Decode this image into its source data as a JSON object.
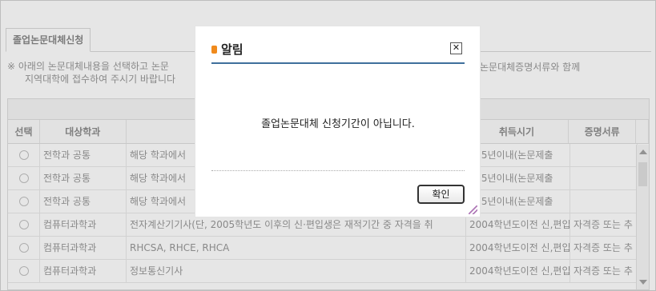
{
  "tab": {
    "label": "졸업논문대체신청"
  },
  "notice": {
    "line1": "※ 아래의 논문대체내용을 선택하고 논문",
    "line1_right": "논문대체증명서류와 함께",
    "line2": "지역대학에 접수하여 주시기 바랍니다"
  },
  "table": {
    "headers": {
      "select": "선택",
      "dept": "대상학과",
      "content": "",
      "period": "취득시기",
      "docs": "증명서류"
    },
    "rows": [
      {
        "dept": "전학과 공통",
        "content": "해당 학과에서",
        "period": "근 5년이내(논문제출",
        "docs": ""
      },
      {
        "dept": "전학과 공통",
        "content": "해당 학과에서",
        "period": "근 5년이내(논문제출",
        "docs": ""
      },
      {
        "dept": "전학과 공통",
        "content": "해당 학과에서",
        "period": "근 5년이내(논문제출",
        "docs": ""
      },
      {
        "dept": "컴퓨터과학과",
        "content": "전자계산기기사(단, 2005학년도 이후의 신·편입생은 재적기간 중 자격을 취",
        "period": "2004학년도이전 신,편입",
        "docs": "자격증 또는 추"
      },
      {
        "dept": "컴퓨터과학과",
        "content": "RHCSA, RHCE, RHCA",
        "period": "2004학년도이전 신,편입",
        "docs": "자격증 또는 추"
      },
      {
        "dept": "컴퓨터과학과",
        "content": "정보통신기사",
        "period": "2004학년도이전 신,편입",
        "docs": "자격증 또는 추"
      }
    ]
  },
  "dialog": {
    "title": "알림",
    "message": "졸업논문대체 신청기간이 아닙니다.",
    "ok_label": "확인",
    "close_glyph": "✕"
  },
  "colors": {
    "accent_rule": "#3f6f9c",
    "title_icon": "#f08a1c"
  }
}
